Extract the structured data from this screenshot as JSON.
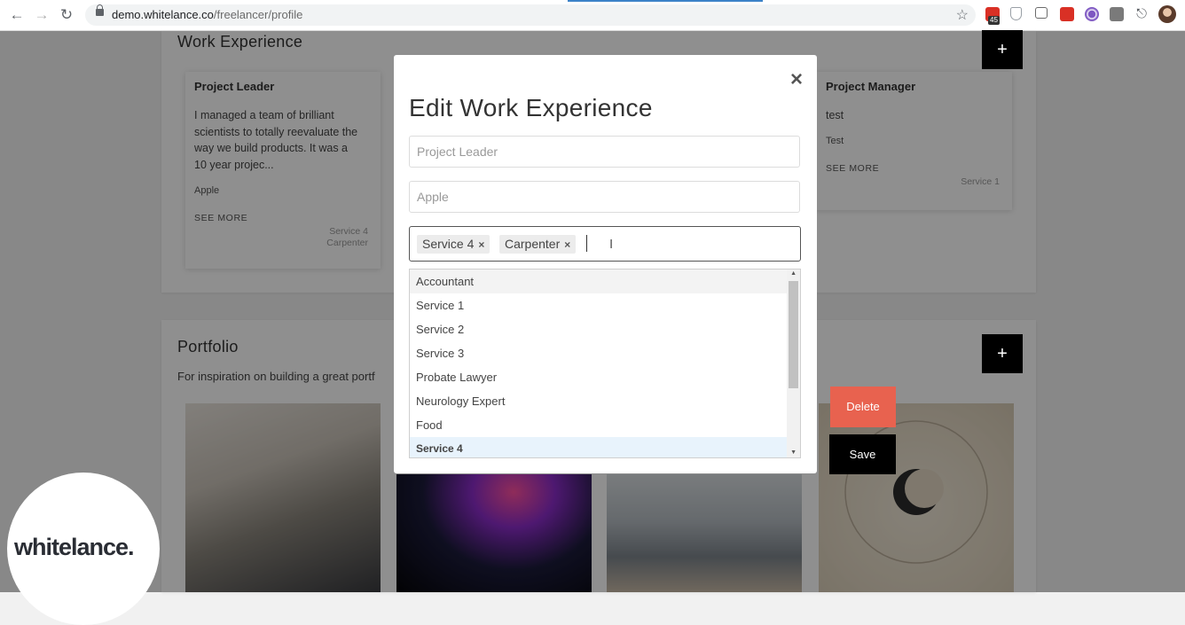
{
  "browser": {
    "url_domain": "demo.whitelance.co",
    "url_path": "/freelancer/profile",
    "extension_badge": "45"
  },
  "work_experience": {
    "title": "Work Experience",
    "add_label": "+",
    "cards": [
      {
        "title": "Project Leader",
        "description": "I managed a team of brilliant scientists to totally reevaluate the way we build products. It was a 10 year projec...",
        "company": "Apple",
        "see_more": "SEE MORE",
        "tag1": "Service 4",
        "tag2": "Carpenter"
      },
      {
        "title": "Project Manager",
        "description": "test",
        "company": "Test",
        "see_more": "SEE MORE",
        "tag1": "Service 1"
      }
    ]
  },
  "portfolio": {
    "title": "Portfolio",
    "add_label": "+",
    "description": "For inspiration on building a great portf"
  },
  "buttons": {
    "delete_label": "Delete",
    "save_label": "Save"
  },
  "modal": {
    "title": "Edit Work Experience",
    "close_label": "×",
    "title_placeholder": "Project Leader",
    "company_placeholder": "Apple",
    "selected_tags": [
      {
        "label": "Service 4",
        "remove": "×"
      },
      {
        "label": "Carpenter",
        "remove": "×"
      }
    ],
    "dropdown_options": [
      "Accountant",
      "Service 1",
      "Service 2",
      "Service 3",
      "Probate Lawyer",
      "Neurology Expert",
      "Food",
      "Service 4"
    ],
    "highlighted_option_index": 7
  },
  "logo": {
    "text": "whitelance."
  }
}
